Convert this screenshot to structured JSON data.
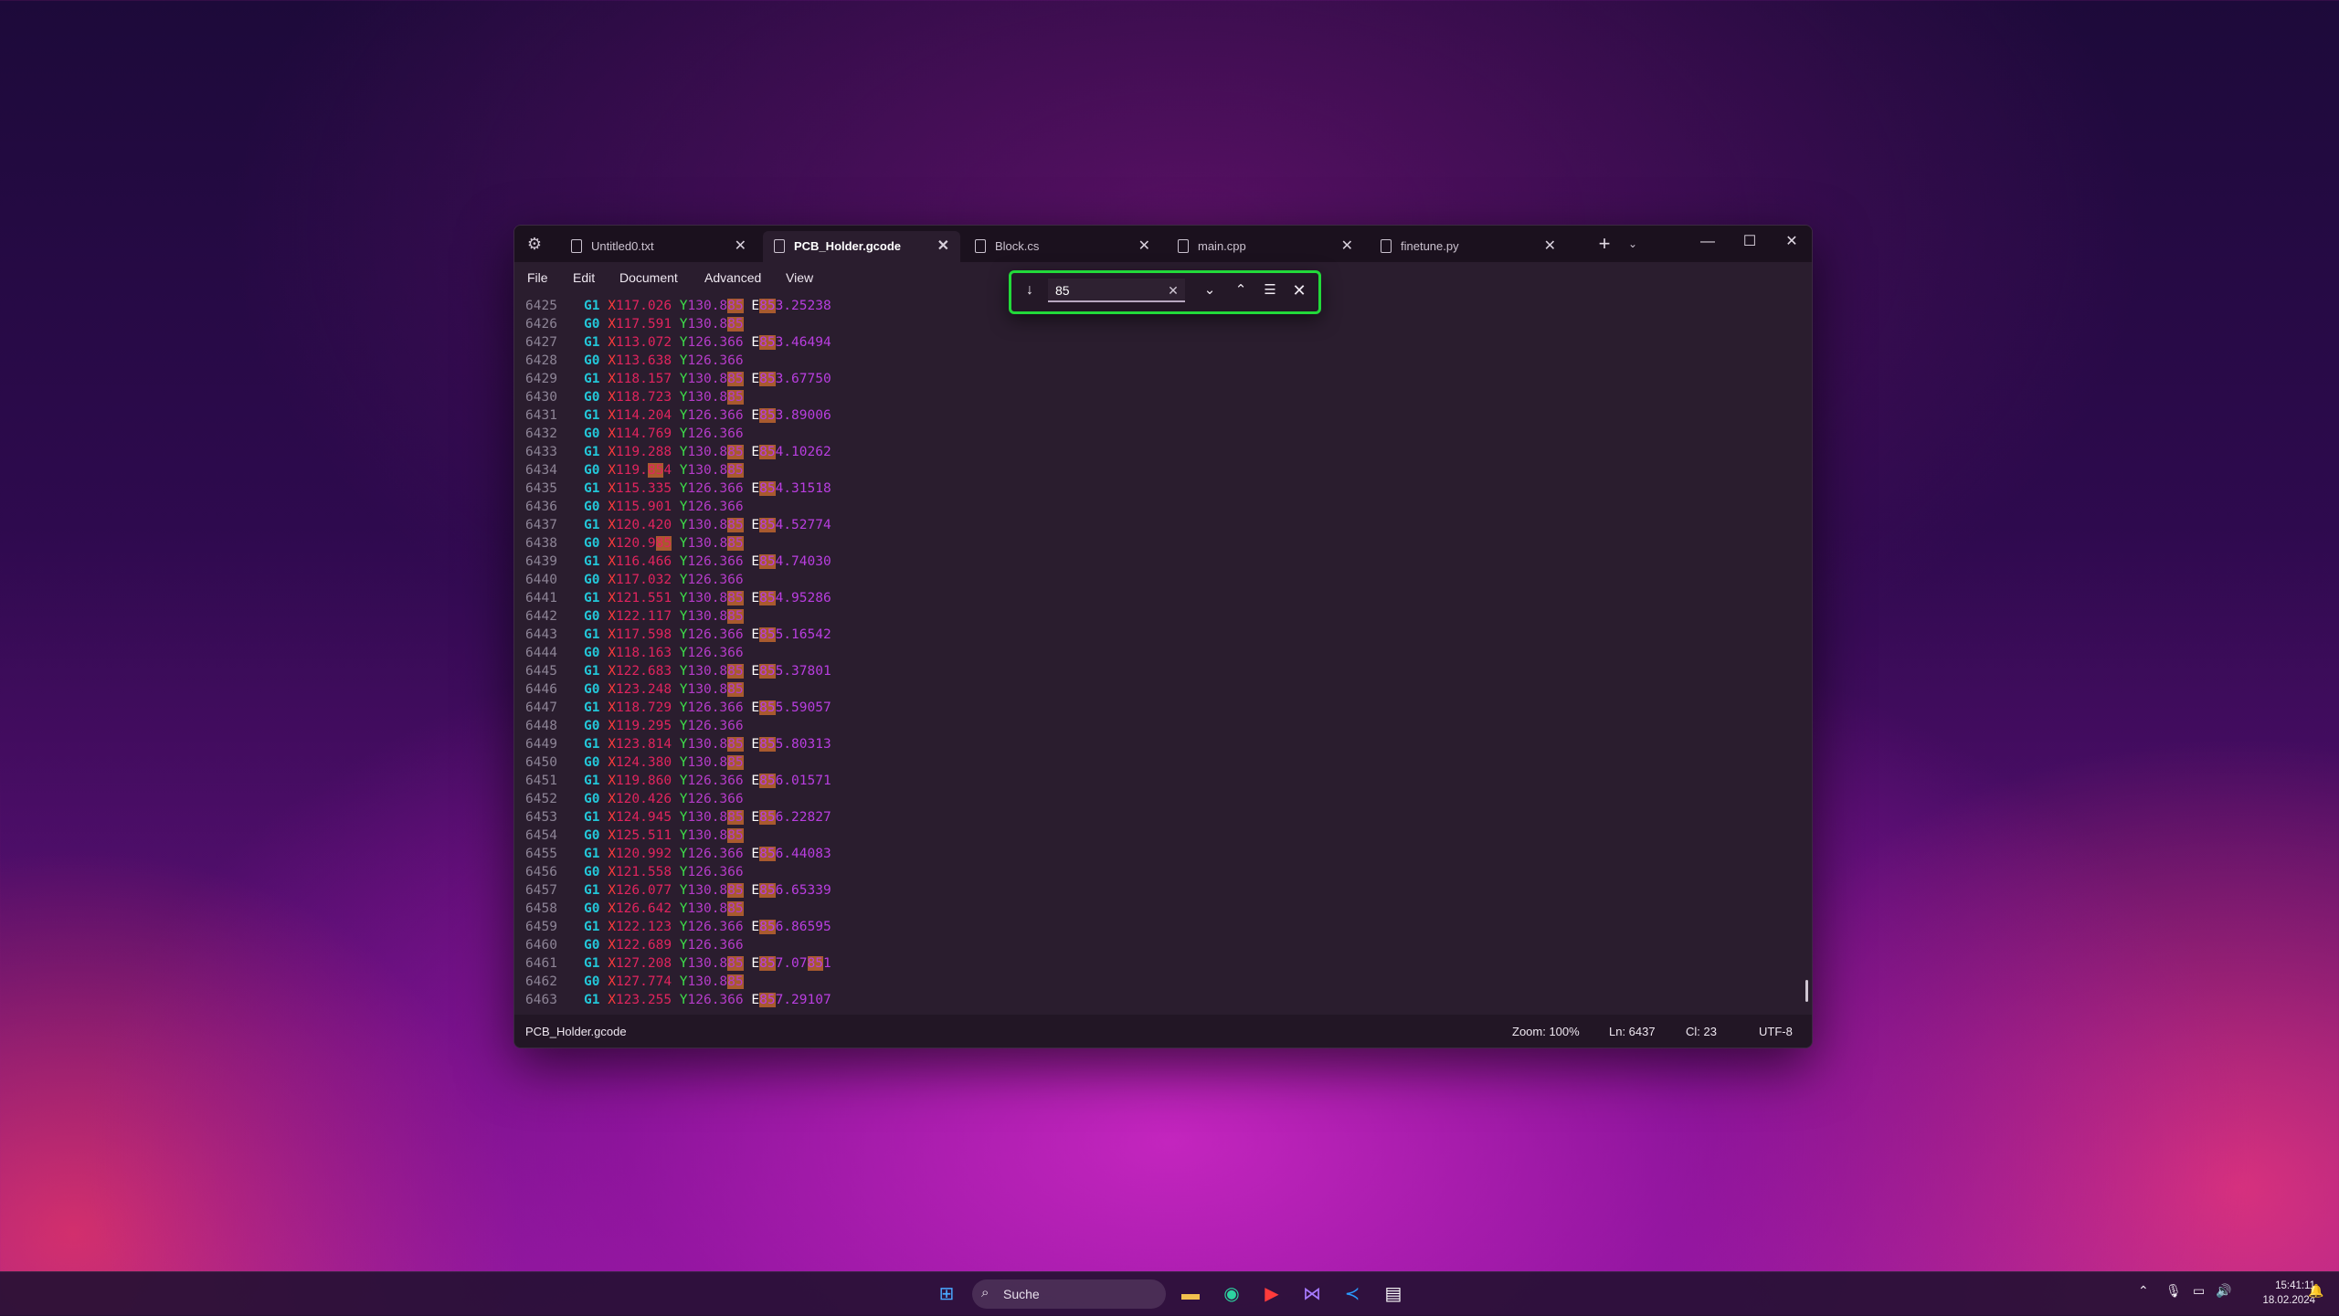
{
  "tabs": [
    {
      "label": "Untitled0.txt"
    },
    {
      "label": "PCB_Holder.gcode"
    },
    {
      "label": "Block.cs"
    },
    {
      "label": "main.cpp"
    },
    {
      "label": "finetune.py"
    }
  ],
  "menu": [
    "File",
    "Edit",
    "Document",
    "Advanced",
    "View"
  ],
  "find": {
    "value": "85"
  },
  "lines": [
    {
      "n": "6425",
      "g": "G1",
      "x": "117.026",
      "y": "130.885",
      "e": "853.25238"
    },
    {
      "n": "6426",
      "g": "G0",
      "x": "117.591",
      "y": "130.885",
      "e": ""
    },
    {
      "n": "6427",
      "g": "G1",
      "x": "113.072",
      "y": "126.366",
      "e": "853.46494"
    },
    {
      "n": "6428",
      "g": "G0",
      "x": "113.638",
      "y": "126.366",
      "e": ""
    },
    {
      "n": "6429",
      "g": "G1",
      "x": "118.157",
      "y": "130.885",
      "e": "853.67750"
    },
    {
      "n": "6430",
      "g": "G0",
      "x": "118.723",
      "y": "130.885",
      "e": ""
    },
    {
      "n": "6431",
      "g": "G1",
      "x": "114.204",
      "y": "126.366",
      "e": "853.89006"
    },
    {
      "n": "6432",
      "g": "G0",
      "x": "114.769",
      "y": "126.366",
      "e": ""
    },
    {
      "n": "6433",
      "g": "G1",
      "x": "119.288",
      "y": "130.885",
      "e": "854.10262"
    },
    {
      "n": "6434",
      "g": "G0",
      "x": "119.854",
      "y": "130.885",
      "e": ""
    },
    {
      "n": "6435",
      "g": "G1",
      "x": "115.335",
      "y": "126.366",
      "e": "854.31518"
    },
    {
      "n": "6436",
      "g": "G0",
      "x": "115.901",
      "y": "126.366",
      "e": ""
    },
    {
      "n": "6437",
      "g": "G1",
      "x": "120.420",
      "y": "130.885",
      "e": "854.52774"
    },
    {
      "n": "6438",
      "g": "G0",
      "x": "120.985",
      "y": "130.885",
      "e": ""
    },
    {
      "n": "6439",
      "g": "G1",
      "x": "116.466",
      "y": "126.366",
      "e": "854.74030"
    },
    {
      "n": "6440",
      "g": "G0",
      "x": "117.032",
      "y": "126.366",
      "e": ""
    },
    {
      "n": "6441",
      "g": "G1",
      "x": "121.551",
      "y": "130.885",
      "e": "854.95286"
    },
    {
      "n": "6442",
      "g": "G0",
      "x": "122.117",
      "y": "130.885",
      "e": ""
    },
    {
      "n": "6443",
      "g": "G1",
      "x": "117.598",
      "y": "126.366",
      "e": "855.16542"
    },
    {
      "n": "6444",
      "g": "G0",
      "x": "118.163",
      "y": "126.366",
      "e": ""
    },
    {
      "n": "6445",
      "g": "G1",
      "x": "122.683",
      "y": "130.885",
      "e": "855.37801"
    },
    {
      "n": "6446",
      "g": "G0",
      "x": "123.248",
      "y": "130.885",
      "e": ""
    },
    {
      "n": "6447",
      "g": "G1",
      "x": "118.729",
      "y": "126.366",
      "e": "855.59057"
    },
    {
      "n": "6448",
      "g": "G0",
      "x": "119.295",
      "y": "126.366",
      "e": ""
    },
    {
      "n": "6449",
      "g": "G1",
      "x": "123.814",
      "y": "130.885",
      "e": "855.80313"
    },
    {
      "n": "6450",
      "g": "G0",
      "x": "124.380",
      "y": "130.885",
      "e": ""
    },
    {
      "n": "6451",
      "g": "G1",
      "x": "119.860",
      "y": "126.366",
      "e": "856.01571"
    },
    {
      "n": "6452",
      "g": "G0",
      "x": "120.426",
      "y": "126.366",
      "e": ""
    },
    {
      "n": "6453",
      "g": "G1",
      "x": "124.945",
      "y": "130.885",
      "e": "856.22827"
    },
    {
      "n": "6454",
      "g": "G0",
      "x": "125.511",
      "y": "130.885",
      "e": ""
    },
    {
      "n": "6455",
      "g": "G1",
      "x": "120.992",
      "y": "126.366",
      "e": "856.44083"
    },
    {
      "n": "6456",
      "g": "G0",
      "x": "121.558",
      "y": "126.366",
      "e": ""
    },
    {
      "n": "6457",
      "g": "G1",
      "x": "126.077",
      "y": "130.885",
      "e": "856.65339"
    },
    {
      "n": "6458",
      "g": "G0",
      "x": "126.642",
      "y": "130.885",
      "e": ""
    },
    {
      "n": "6459",
      "g": "G1",
      "x": "122.123",
      "y": "126.366",
      "e": "856.86595"
    },
    {
      "n": "6460",
      "g": "G0",
      "x": "122.689",
      "y": "126.366",
      "e": ""
    },
    {
      "n": "6461",
      "g": "G1",
      "x": "127.208",
      "y": "130.885",
      "e": "857.07851"
    },
    {
      "n": "6462",
      "g": "G0",
      "x": "127.774",
      "y": "130.885",
      "e": ""
    },
    {
      "n": "6463",
      "g": "G1",
      "x": "123.255",
      "y": "126.366",
      "e": "857.29107"
    }
  ],
  "status": {
    "file": "PCB_Holder.gcode",
    "zoom": "Zoom: 100%",
    "ln": "Ln: 6437",
    "col": "Cl: 23",
    "enc": "UTF-8"
  },
  "taskbar": {
    "search": "Suche",
    "time": "15:41:11",
    "date": "18.02.2024"
  },
  "colors": {
    "find_border": "#22d93a",
    "match_highlight": "#a85a2e",
    "g_code": "#23c6d8",
    "x_axis": "#ff3b3b",
    "y_axis": "#3ee04a"
  }
}
